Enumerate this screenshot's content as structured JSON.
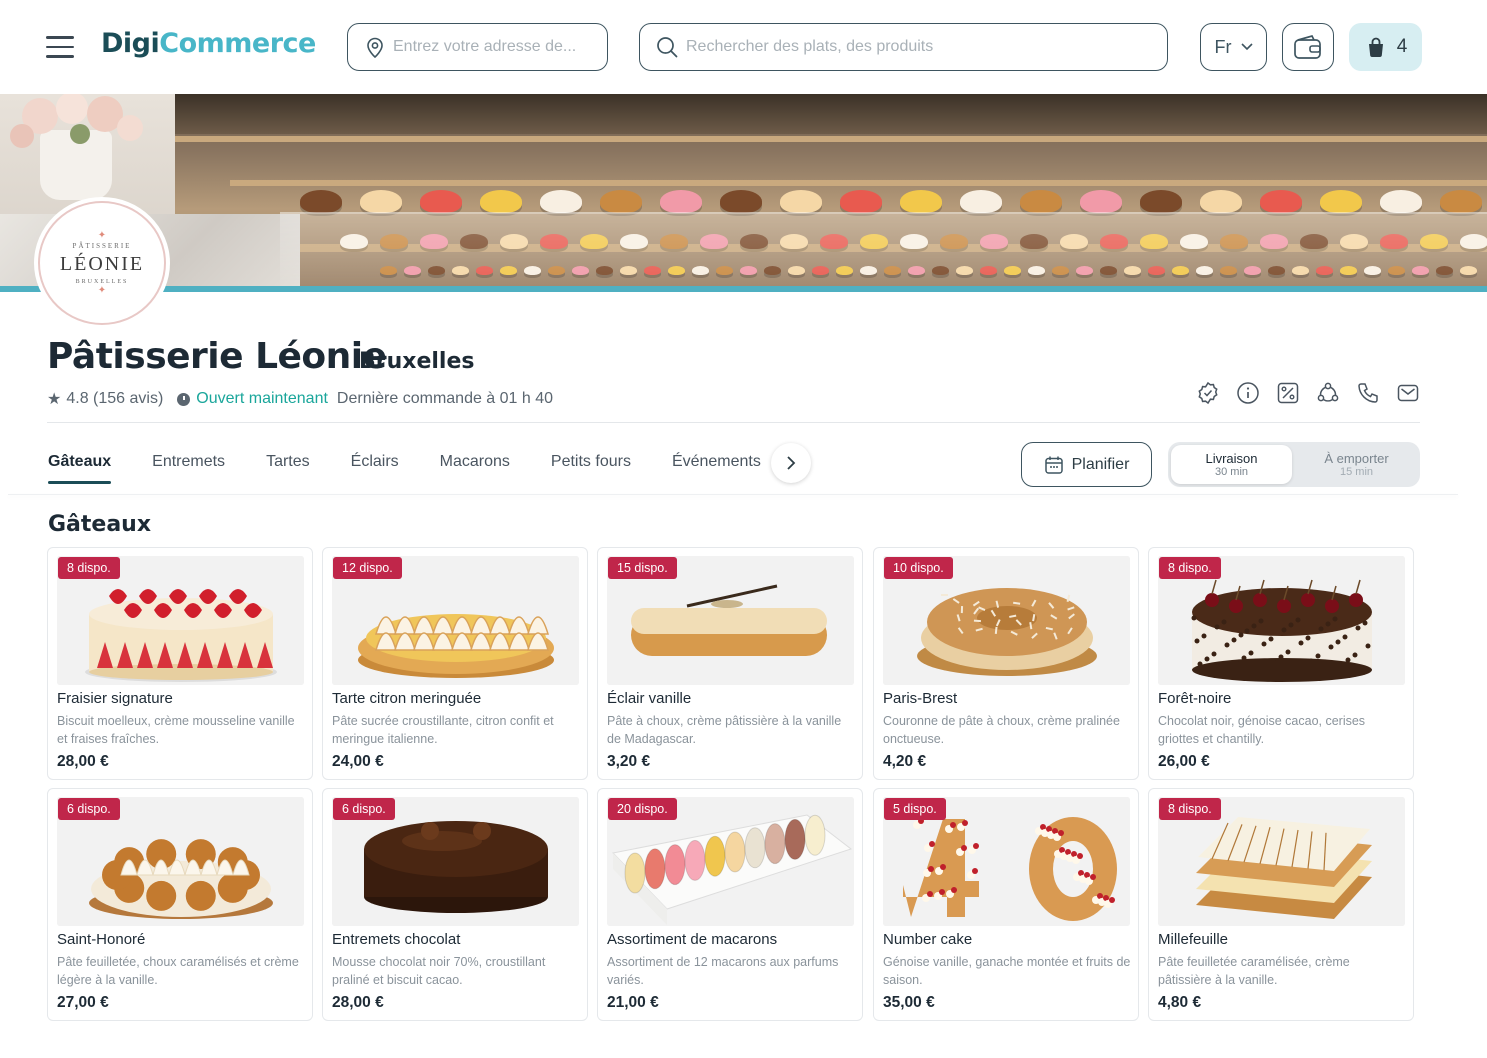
{
  "header": {
    "logo_part1": "Digi",
    "logo_part2": "Commerce",
    "address_placeholder": "Entrez votre adresse de...",
    "search_placeholder": "Rechercher des plats, des produits",
    "language": "Fr",
    "cart_count": "4",
    "accent_color": "#48b6c8"
  },
  "shop": {
    "logo_top": "PÂTISSERIE",
    "logo_name": "LÉONIE",
    "logo_bottom": "BRUXELLES",
    "name": "Pâtisserie Léonie",
    "city": "Bruxelles",
    "rating": "4.8 (156 avis)",
    "status": "Ouvert maintenant",
    "last_order": "Dernière commande à 01 h 40",
    "action_icons": [
      "badge-check-icon",
      "info-icon",
      "discount-icon",
      "share-icon",
      "phone-icon",
      "mail-icon"
    ]
  },
  "tabs": [
    "Gâteaux",
    "Entremets",
    "Tartes",
    "Éclairs",
    "Macarons",
    "Petits fours",
    "Événements"
  ],
  "active_tab": "Gâteaux",
  "plan_label": "Planifier",
  "mode": {
    "delivery": {
      "title": "Livraison",
      "time": "30 min"
    },
    "takeaway": {
      "title": "À emporter",
      "time": "15 min"
    }
  },
  "section_title": "Gâteaux",
  "products": [
    {
      "badge": "8 dispo.",
      "name": "Fraisier signature",
      "desc": "Biscuit moelleux, crème mousseline vanille et fraises fraîches.",
      "price": "28,00 €",
      "image": "strawberry-cake"
    },
    {
      "badge": "12 dispo.",
      "name": "Tarte citron meringuée",
      "desc": "Pâte sucrée croustillante, citron confit et meringue italienne.",
      "price": "24,00 €",
      "image": "lemon-tart"
    },
    {
      "badge": "15 dispo.",
      "name": "Éclair vanille",
      "desc": "Pâte à choux, crème pâtissière à la vanille de Madagascar.",
      "price": "3,20 €",
      "image": "eclair"
    },
    {
      "badge": "10 dispo.",
      "name": "Paris-Brest",
      "desc": "Couronne de pâte à choux, crème pralinée onctueuse.",
      "price": "4,20 €",
      "image": "paris-brest"
    },
    {
      "badge": "8 dispo.",
      "name": "Forêt-noire",
      "desc": "Chocolat noir, génoise cacao, cerises griottes et chantilly.",
      "price": "26,00 €",
      "image": "black-forest"
    },
    {
      "badge": "6 dispo.",
      "name": "Saint-Honoré",
      "desc": "Pâte feuilletée, choux caramélisés et crème légère à la vanille.",
      "price": "27,00 €",
      "image": "saint-honore"
    },
    {
      "badge": "6 dispo.",
      "name": "Entremets chocolat",
      "desc": "Mousse chocolat noir 70%, croustillant praliné et biscuit cacao.",
      "price": "28,00 €",
      "image": "chocolate-cake"
    },
    {
      "badge": "20 dispo.",
      "name": "Assortiment de macarons",
      "desc": "Assortiment de 12 macarons aux parfums variés.",
      "price": "21,00 €",
      "image": "macarons-box"
    },
    {
      "badge": "5 dispo.",
      "name": "Number cake",
      "desc": "Génoise vanille, ganache montée et fruits de saison.",
      "price": "35,00 €",
      "image": "number-cake"
    },
    {
      "badge": "8 dispo.",
      "name": "Millefeuille",
      "desc": "Pâte feuilletée caramélisée, crème pâtissière à la vanille.",
      "price": "4,80 €",
      "image": "millefeuille"
    }
  ]
}
